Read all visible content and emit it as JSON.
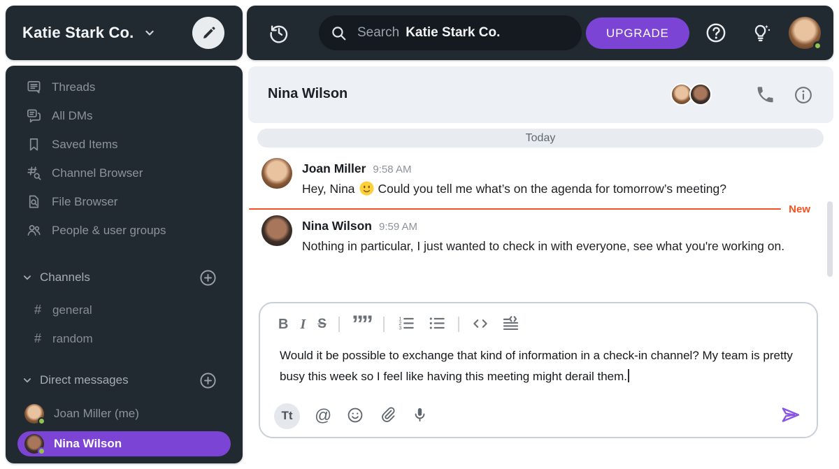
{
  "workspace": {
    "name": "Katie Stark Co."
  },
  "topbar": {
    "search_label": "Search",
    "search_scope": "Katie Stark Co.",
    "upgrade_label": "UPGRADE"
  },
  "sidebar": {
    "nav": [
      {
        "label": "Threads"
      },
      {
        "label": "All DMs"
      },
      {
        "label": "Saved Items"
      },
      {
        "label": "Channel Browser"
      },
      {
        "label": "File Browser"
      },
      {
        "label": "People & user groups"
      }
    ],
    "channels": {
      "header": "Channels",
      "items": [
        {
          "name": "general"
        },
        {
          "name": "random"
        }
      ]
    },
    "dms": {
      "header": "Direct messages",
      "items": [
        {
          "name": "Joan Miller (me)"
        },
        {
          "name": "Nina Wilson",
          "active": true
        }
      ]
    }
  },
  "chat": {
    "title": "Nina Wilson",
    "date_divider": "Today",
    "new_label": "New",
    "messages": [
      {
        "author": "Joan Miller",
        "time": "9:58 AM",
        "text_start": "Hey, Nina",
        "emoji": "slightly-smiling-face",
        "text_end": "Could you tell me what’s on the agenda for tomorrow’s meeting?"
      },
      {
        "author": "Nina Wilson",
        "time": "9:59 AM",
        "text": "Nothing in particular, I just wanted to check in with everyone, see what you're working on."
      }
    ]
  },
  "composer": {
    "value": "Would it be possible to exchange that kind of information in a check-in channel? My team is pretty busy this week so I feel like having this meeting might derail them."
  },
  "icons": {
    "hash": "#",
    "at": "@",
    "bold": "B",
    "italic": "I",
    "strike": "S",
    "quote": "””",
    "format": "Tt"
  },
  "colors": {
    "dark_surface": "#222a31",
    "accent_purple": "#7c44d4",
    "send_purple": "#8a55e6",
    "new_orange": "#f4511e",
    "presence_green": "#93c24f",
    "header_bg": "#edf1f5"
  }
}
